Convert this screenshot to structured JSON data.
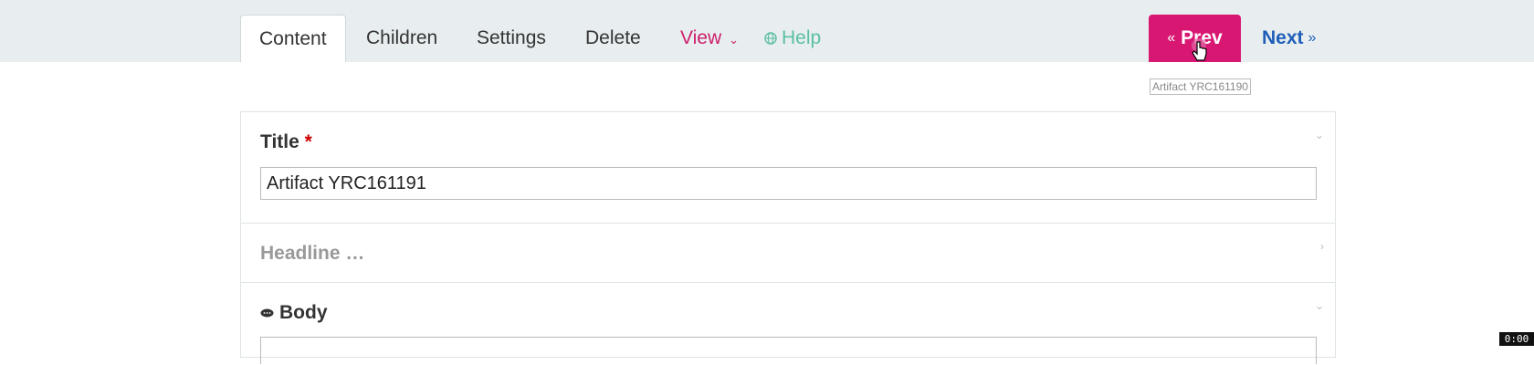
{
  "tabs": {
    "content": "Content",
    "children": "Children",
    "settings": "Settings",
    "delete": "Delete",
    "view": "View",
    "help": "Help"
  },
  "pager": {
    "prev_arrow": "«",
    "prev_label": "Prev",
    "next_label": "Next",
    "next_arrow": "»",
    "tooltip": "Artifact YRC161190"
  },
  "form": {
    "title_label": "Title",
    "required_mark": "*",
    "title_value": "Artifact YRC161191",
    "headline_label": "Headline …",
    "body_label": "Body"
  },
  "timer": "0:00",
  "colors": {
    "accent": "#d81773",
    "link": "#1f5fb8",
    "help": "#5bbfa0",
    "view": "#cc1f6a"
  }
}
